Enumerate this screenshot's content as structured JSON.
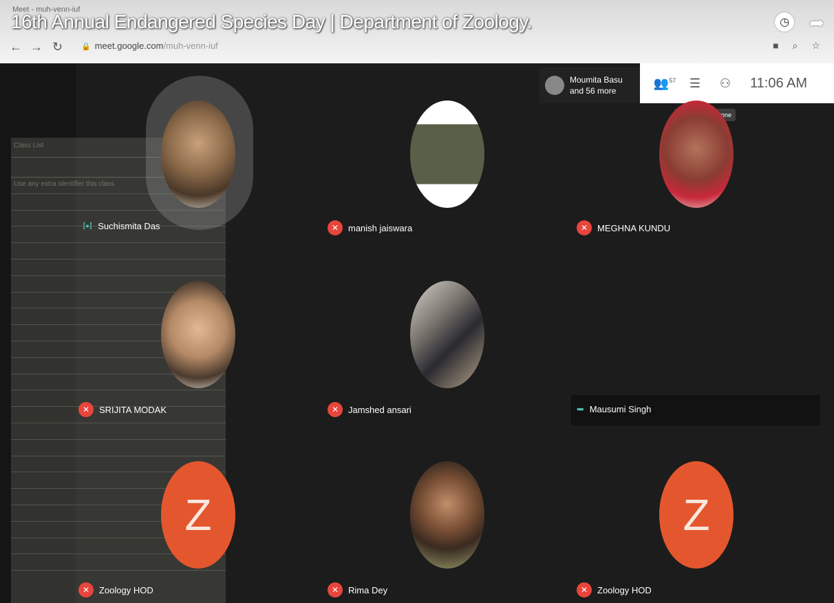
{
  "window": {
    "tab_text": "Meet - muh-venn-iuf",
    "title_overlay": "16th Annual Endangered Species Day | Department of Zoology.",
    "url_host": "meet.google.com",
    "url_path": "/muh-venn-iuf"
  },
  "meet": {
    "clock": "11:06 AM",
    "participants_count": "57",
    "presenting_line1": "Moumita Basu",
    "presenting_line2": "and 56 more",
    "tooltip": "Chat with everyone"
  },
  "tiles": [
    {
      "name": "Suchismita Das",
      "state": "speaking"
    },
    {
      "name": "manish jaiswara",
      "state": "muted"
    },
    {
      "name": "MEGHNA KUNDU",
      "state": "muted"
    },
    {
      "name": "SRIJITA MODAK",
      "state": "muted"
    },
    {
      "name": "Jamshed ansari",
      "state": "muted"
    },
    {
      "name": "Mausumi Singh",
      "state": "dots"
    },
    {
      "name": "Zoology HOD",
      "state": "muted",
      "avatar_letter": "Z"
    },
    {
      "name": "Rima Dey",
      "state": "muted"
    },
    {
      "name": "Zoology HOD",
      "state": "muted",
      "avatar_letter": "Z"
    }
  ],
  "attendance_panel": {
    "header": "Class List",
    "subheader": "Use any extra identifier this class"
  },
  "colors": {
    "mute_red": "#e8453c",
    "z_avatar": "#e4572e",
    "speaking_teal": "#4fc3b0"
  }
}
